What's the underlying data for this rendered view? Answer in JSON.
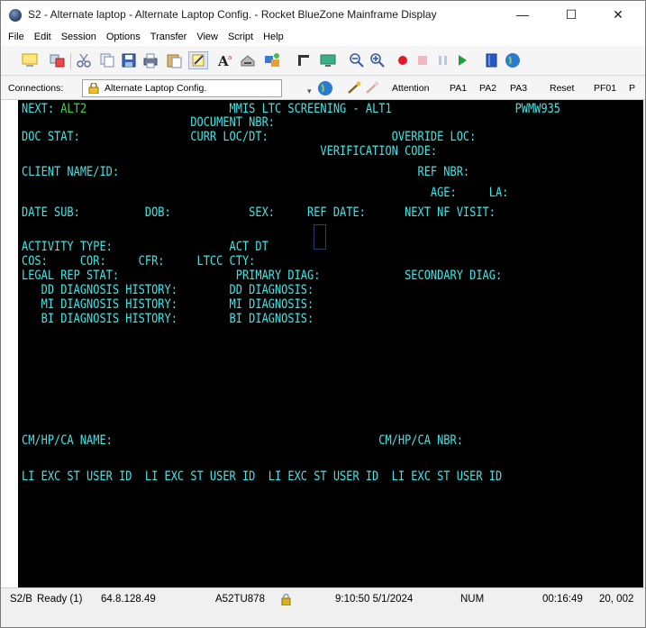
{
  "window": {
    "title": "S2 - Alternate laptop - Alternate Laptop Config. - Rocket BlueZone Mainframe Display",
    "minimize": "—",
    "maximize": "☐",
    "close": "✕"
  },
  "menu": [
    "File",
    "Edit",
    "Session",
    "Options",
    "Transfer",
    "View",
    "Script",
    "Help"
  ],
  "toolbar_icons": [
    "new-session-icon",
    "connect-icon",
    "cut-icon",
    "copy-icon",
    "save-icon",
    "print-icon",
    "paste-icon",
    "edit-icon",
    "font-icon",
    "printer-icon",
    "transfer-icon",
    "send-icon",
    "receive-icon",
    "zoom-out-icon",
    "zoom-in-icon",
    "record-icon",
    "stop-icon",
    "pause-icon",
    "play-icon",
    "book-icon",
    "globe-icon"
  ],
  "connections": {
    "label": "Connections:",
    "selected": "Alternate Laptop Config.",
    "keys": [
      "Attention",
      "PA1",
      "PA2",
      "PA3",
      "Reset",
      "PF01",
      "P"
    ]
  },
  "screen": {
    "next_label": "NEXT: ",
    "next_value": "ALT2",
    "title": "MMIS LTC SCREENING - ALT1",
    "screen_id": "PWMW935",
    "lines": [
      "                          DOCUMENT NBR:",
      "DOC STAT:                 CURR LOC/DT:                   OVERRIDE LOC:",
      "                                              VERIFICATION CODE:",
      "CLIENT NAME/ID:                                              REF NBR:",
      "                                                               AGE:     LA:",
      "DATE SUB:          DOB:            SEX:     REF DATE:      NEXT NF VISIT:",
      "",
      "ACTIVITY TYPE:                  ACT DT",
      "COS:     COR:     CFR:     LTCC CTY:",
      "LEGAL REP STAT:                  PRIMARY DIAG:             SECONDARY DIAG:",
      "   DD DIAGNOSIS HISTORY:        DD DIAGNOSIS:",
      "   MI DIAGNOSIS HISTORY:        MI DIAGNOSIS:",
      "   BI DIAGNOSIS HISTORY:        BI DIAGNOSIS:",
      "",
      "",
      "",
      "CM/HP/CA NAME:                                         CM/HP/CA NBR:",
      "",
      "",
      "LI EXC ST USER ID  LI EXC ST USER ID  LI EXC ST USER ID  LI EXC ST USER ID"
    ]
  },
  "status": {
    "session": "S2/B",
    "state": "Ready (1)",
    "ip": "64.8.128.49",
    "terminal_id": "A52TU878",
    "datetime": "9:10:50 5/1/2024",
    "num": "NUM",
    "elapsed": "00:16:49",
    "cursor_pos": "20, 002"
  },
  "colors": {
    "terminal_bg": "#000000",
    "field_text": "#41e6e6",
    "input_text": "#3cd94a"
  }
}
